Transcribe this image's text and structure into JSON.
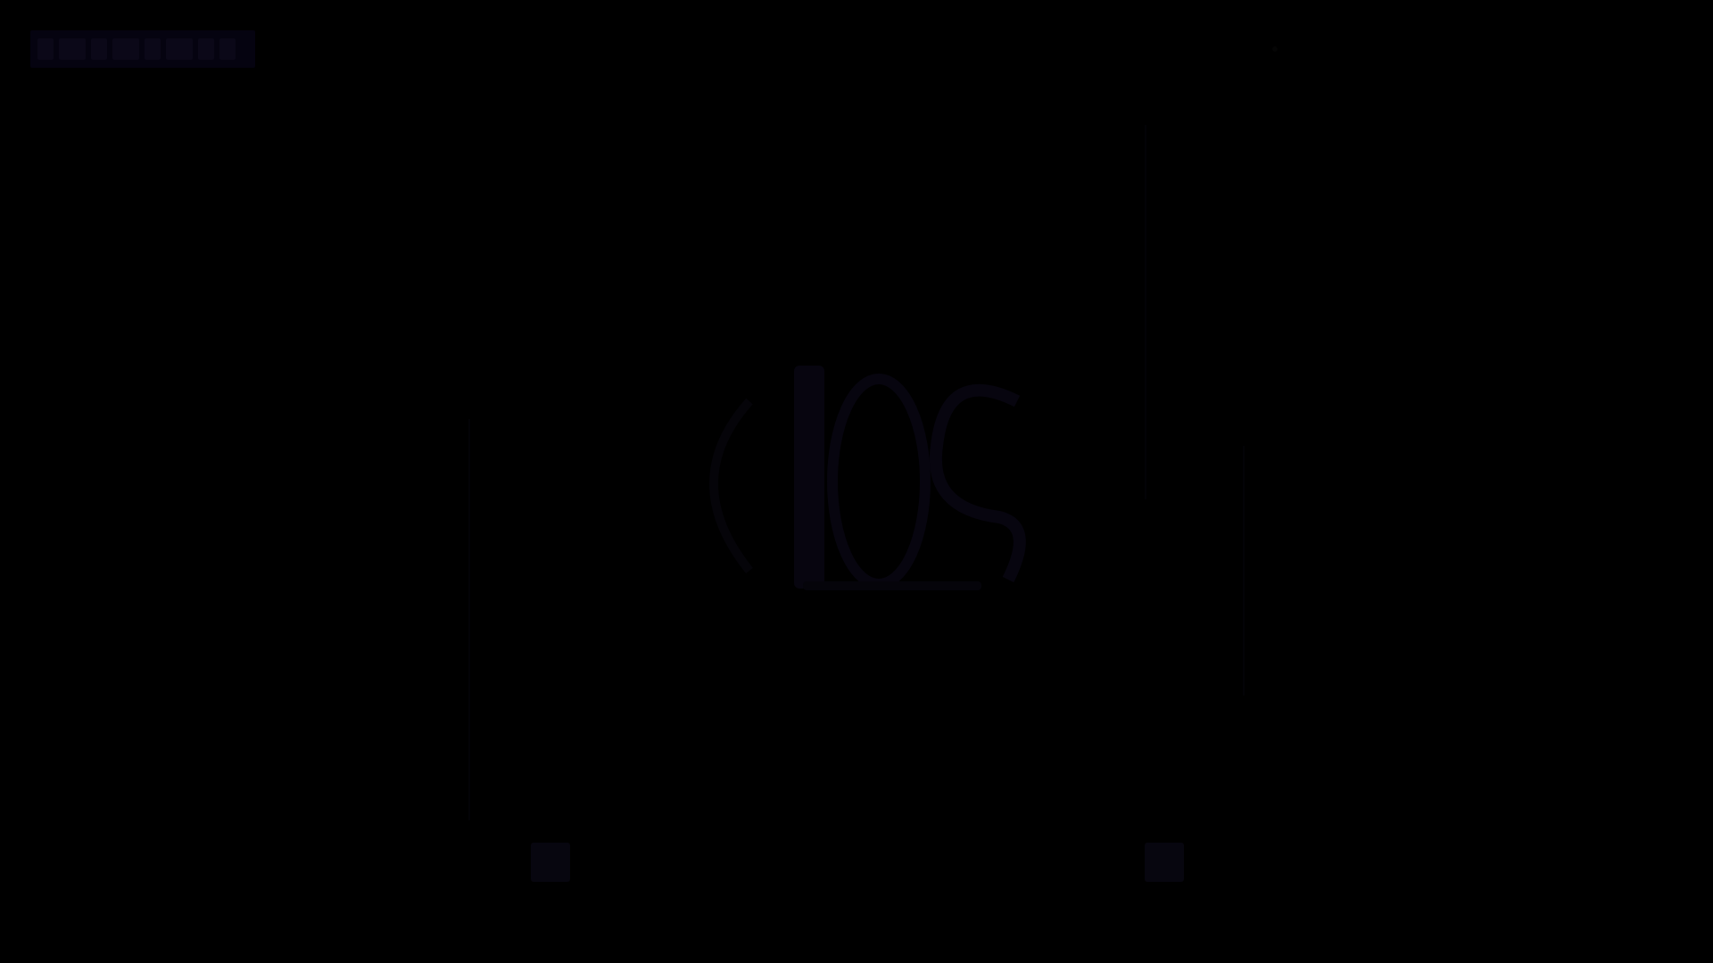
{
  "screen": {
    "background": "#000000"
  },
  "logo": {
    "icon": "brand-logo-icon",
    "color": "#050310"
  },
  "emblem": {
    "icon": "center-emblem-icon",
    "color": "#0a0816"
  },
  "icons": {
    "indicator": "status-dot-icon",
    "left_mark": "corner-mark-icon",
    "right_mark": "corner-mark-icon"
  }
}
